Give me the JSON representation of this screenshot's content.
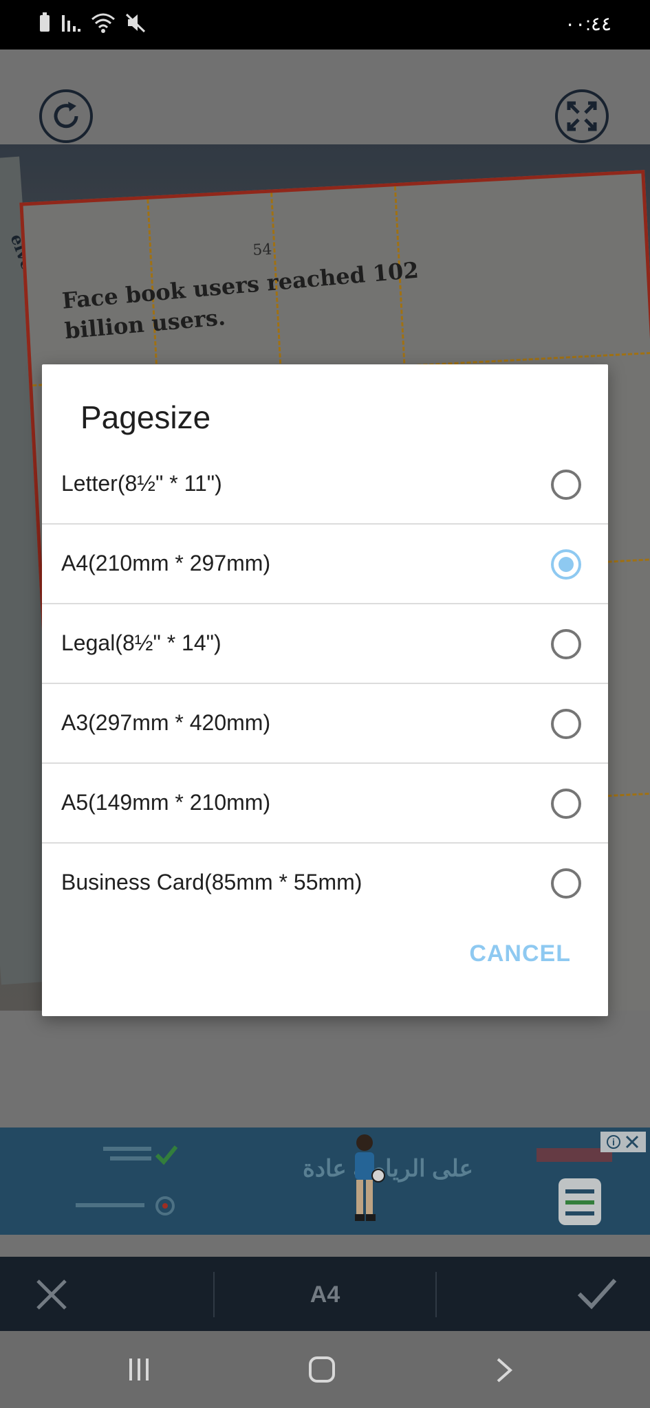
{
  "status_bar": {
    "time": "٠٠:٤٤",
    "icons": [
      "battery-icon",
      "signal-icon",
      "wifi-icon",
      "mute-icon"
    ]
  },
  "top_bar": {
    "icons": [
      "rotate-icon",
      "fullscreen-icon"
    ]
  },
  "photo": {
    "page_number": "54",
    "text_line1": "Face book users reached 102",
    "text_line2": "billion users.",
    "side_word": "eived"
  },
  "dialog": {
    "title": "Pagesize",
    "options": [
      {
        "label": "Letter(8½\" * 11\")",
        "selected": false
      },
      {
        "label": "A4(210mm * 297mm)",
        "selected": true
      },
      {
        "label": "Legal(8½\" * 14\")",
        "selected": false
      },
      {
        "label": "A3(297mm * 420mm)",
        "selected": false
      },
      {
        "label": "A5(149mm * 210mm)",
        "selected": false
      },
      {
        "label": "Business Card(85mm * 55mm)",
        "selected": false
      }
    ],
    "cancel_label": "CANCEL",
    "accent_color": "#8ec9f1"
  },
  "ad": {
    "center_text": "على الرياضة عادة",
    "close_icons": [
      "info-icon",
      "close-icon"
    ]
  },
  "toolbar": {
    "page_size": "A4",
    "icons": [
      "close-icon",
      "check-icon"
    ]
  },
  "nav_bar": {
    "icons": [
      "recent-apps-icon",
      "home-icon",
      "back-icon"
    ]
  }
}
